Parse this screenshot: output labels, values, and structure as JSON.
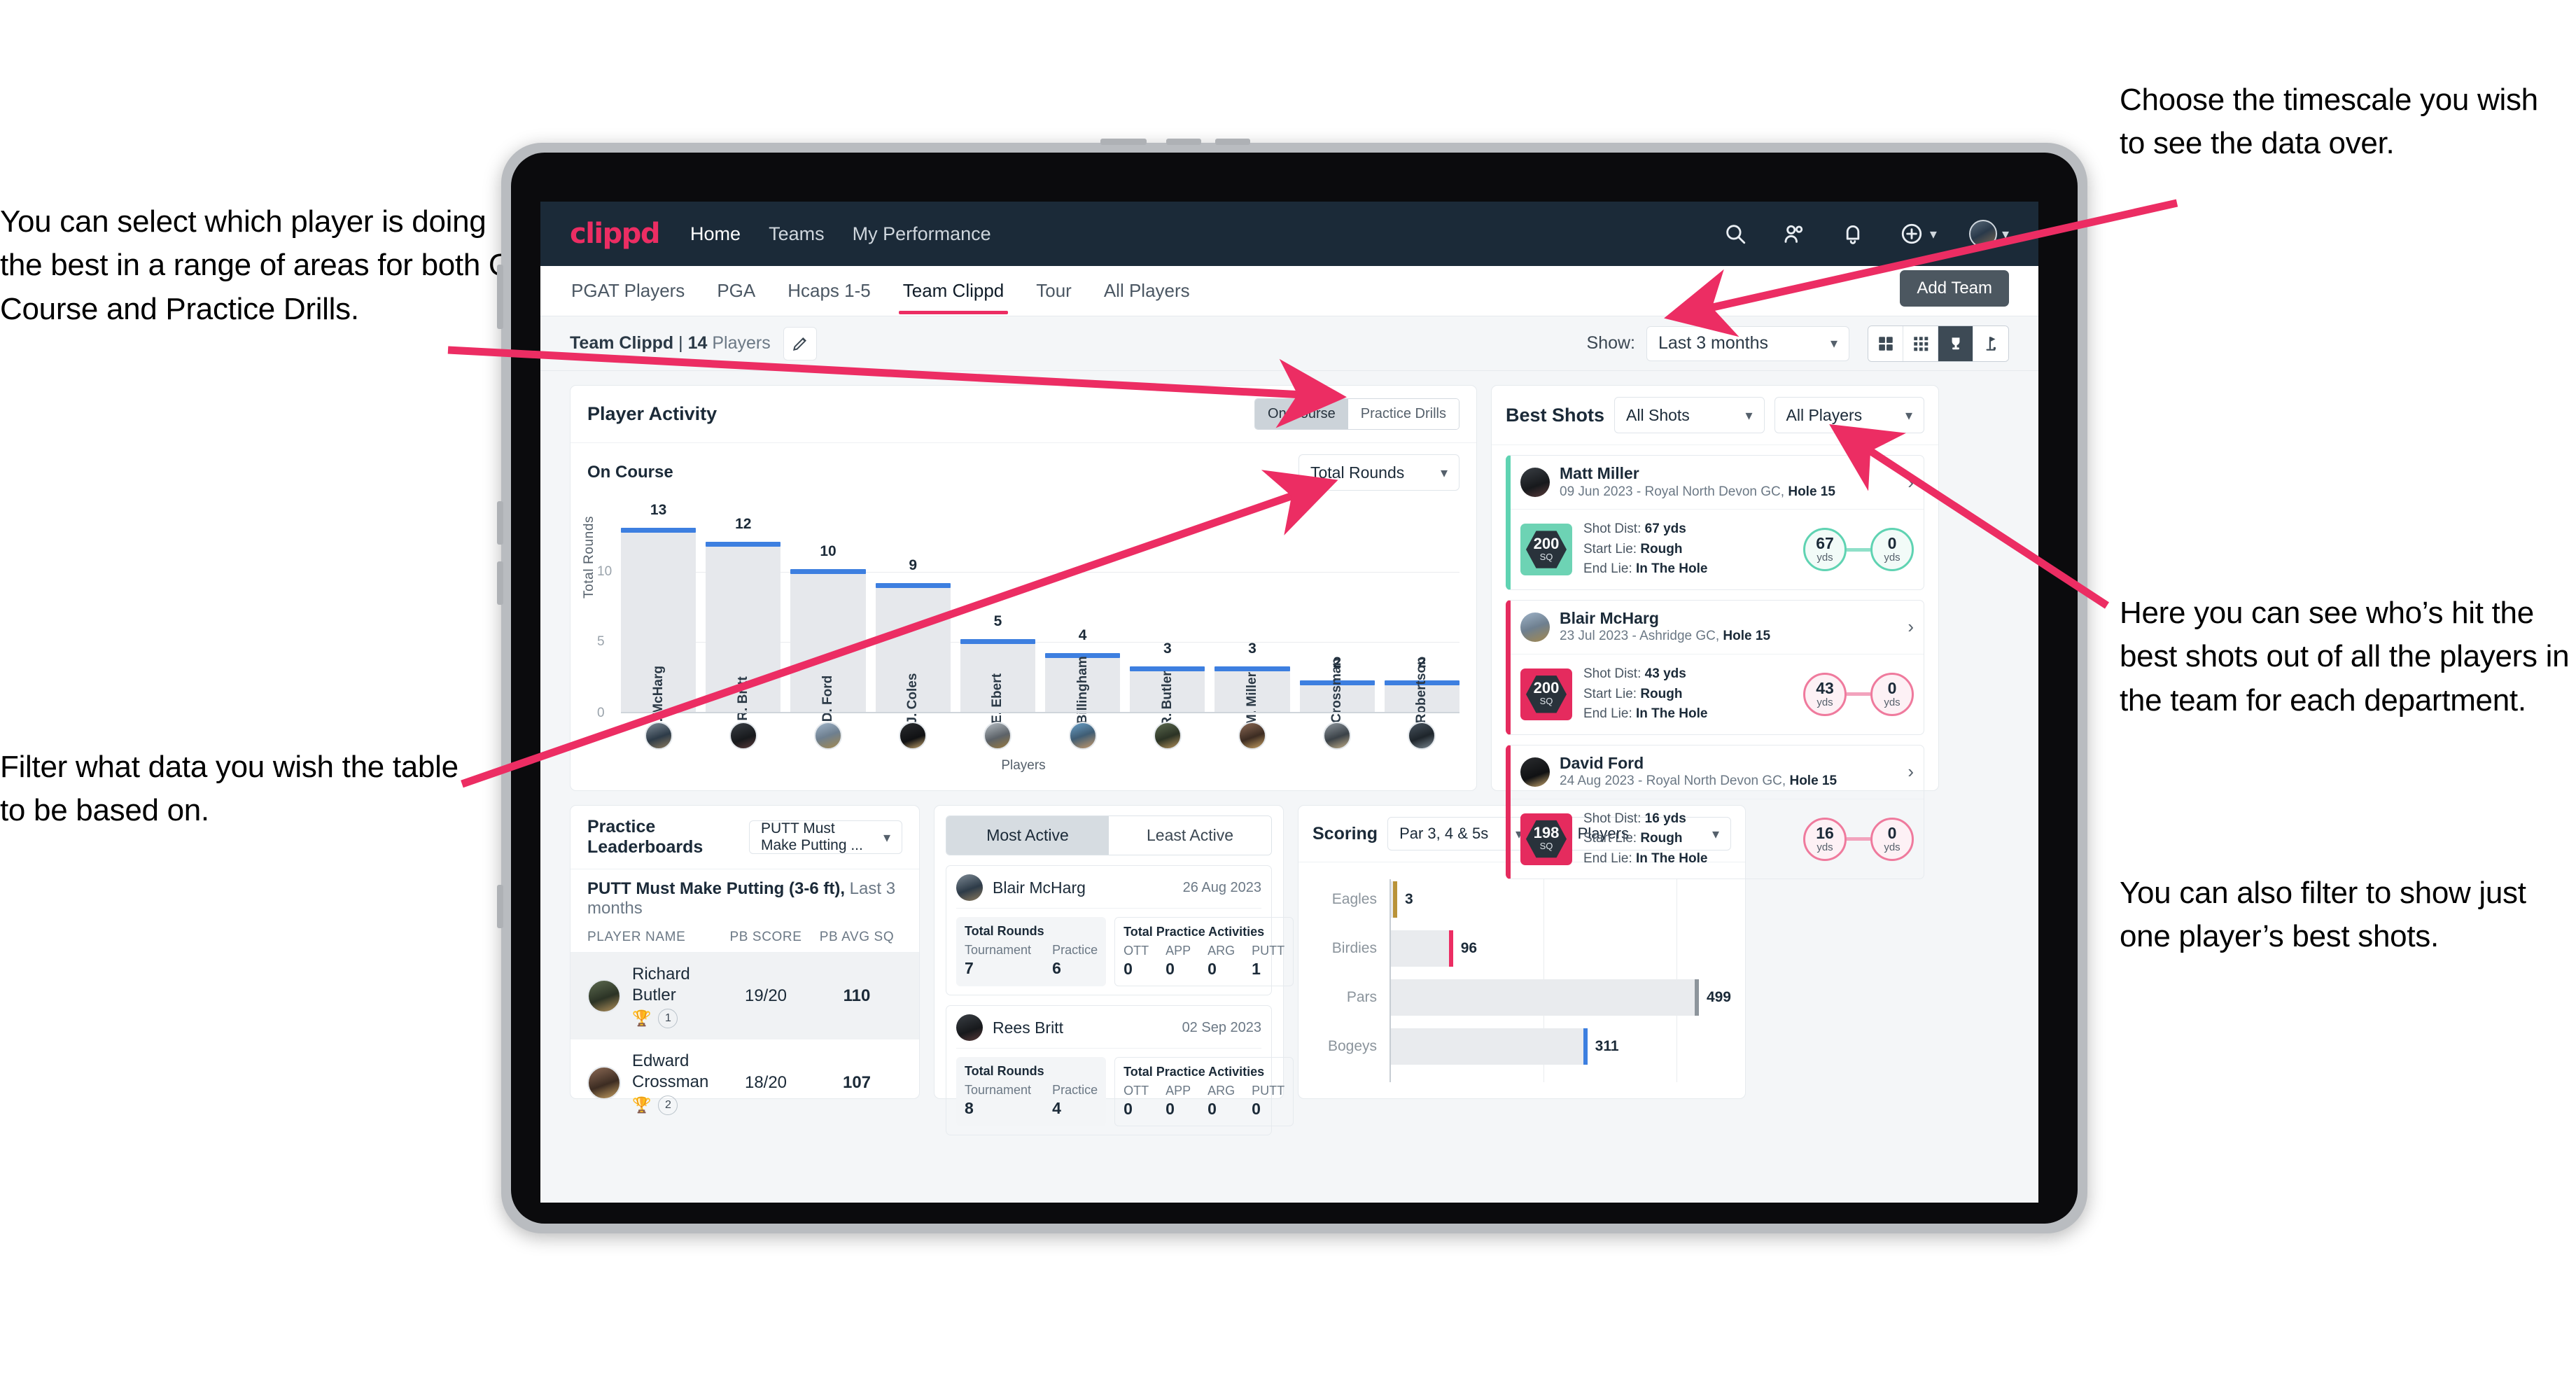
{
  "annotations": {
    "left_top": "You can select which player is doing the best in a range of areas for both On Course and Practice Drills.",
    "left_bottom": "Filter what data you wish the table to be based on.",
    "right_top": "Choose the timescale you wish to see the data over.",
    "right_middle": "Here you can see who’s hit the best shots out of all the players in the team for each department.",
    "right_bottom": "You can also filter to show just one player’s best shots."
  },
  "navbar": {
    "logo": "clippd",
    "links": [
      {
        "label": "Home",
        "active": true
      },
      {
        "label": "Teams",
        "active": false
      },
      {
        "label": "My Performance",
        "active": false
      }
    ],
    "icons": [
      "search-icon",
      "people-icon",
      "bell-icon",
      "plus-circle-icon",
      "avatar"
    ],
    "accent": "#ec2d63",
    "background": "#1b2a38"
  },
  "tabs": {
    "items": [
      "PGAT Players",
      "PGA",
      "Hcaps 1-5",
      "Team Clippd",
      "Tour",
      "All Players"
    ],
    "active": "Team Clippd",
    "tooltip": "Add Team"
  },
  "subheader": {
    "team_name": "Team Clippd",
    "separator": "|",
    "player_count": "14",
    "players_word": "Players",
    "edit_icon": "pencil-icon",
    "show_label": "Show:",
    "timescale": "Last 3 months",
    "view_toggles": [
      {
        "name": "grid-large-icon",
        "active": false
      },
      {
        "name": "grid-small-icon",
        "active": false
      },
      {
        "name": "trophy-icon",
        "active": true
      },
      {
        "name": "flag-icon",
        "active": false
      }
    ]
  },
  "player_activity": {
    "title": "Player Activity",
    "segment": {
      "options": [
        "On Course",
        "Practice Drills"
      ],
      "active": "On Course"
    },
    "sub_label": "On Course",
    "metric_select": "Total Rounds"
  },
  "chart_data": {
    "type": "bar",
    "title": "Player Activity — On Course",
    "xlabel": "Players",
    "ylabel": "Total Rounds",
    "ylim": [
      0,
      14
    ],
    "yticks": [
      0,
      5,
      10
    ],
    "grid": true,
    "categories": [
      "B. McHarg",
      "R. Britt",
      "D. Ford",
      "J. Coles",
      "E. Ebert",
      "D. Billingham",
      "R. Butler",
      "M. Miller",
      "E. Crossman",
      "C. Robertson"
    ],
    "values": [
      13,
      12,
      10,
      9,
      5,
      4,
      3,
      3,
      2,
      2
    ]
  },
  "best_shots": {
    "title": "Best Shots",
    "shot_filter": "All Shots",
    "player_filter": "All Players",
    "items": [
      {
        "player": "Matt Miller",
        "meta_date": "09 Jun 2023",
        "meta_course": "Royal North Devon GC,",
        "meta_hole": "Hole 15",
        "sq": "200",
        "sq_unit": "SQ",
        "shot_dist_label": "Shot Dist:",
        "shot_dist": "67 yds",
        "start_lie_label": "Start Lie:",
        "start_lie": "Rough",
        "end_lie_label": "End Lie:",
        "end_lie": "In The Hole",
        "from_yds": "67",
        "to_yds": "0",
        "unit": "yds",
        "color": "teal"
      },
      {
        "player": "Blair McHarg",
        "meta_date": "23 Jul 2023",
        "meta_course": "Ashridge GC,",
        "meta_hole": "Hole 15",
        "sq": "200",
        "sq_unit": "SQ",
        "shot_dist_label": "Shot Dist:",
        "shot_dist": "43 yds",
        "start_lie_label": "Start Lie:",
        "start_lie": "Rough",
        "end_lie_label": "End Lie:",
        "end_lie": "In The Hole",
        "from_yds": "43",
        "to_yds": "0",
        "unit": "yds",
        "color": "pink"
      },
      {
        "player": "David Ford",
        "meta_date": "24 Aug 2023",
        "meta_course": "Royal North Devon GC,",
        "meta_hole": "Hole 15",
        "sq": "198",
        "sq_unit": "SQ",
        "shot_dist_label": "Shot Dist:",
        "shot_dist": "16 yds",
        "start_lie_label": "Start Lie:",
        "start_lie": "Rough",
        "end_lie_label": "End Lie:",
        "end_lie": "In The Hole",
        "from_yds": "16",
        "to_yds": "0",
        "unit": "yds",
        "color": "pink"
      }
    ]
  },
  "practice_leaderboards": {
    "title": "Practice Leaderboards",
    "drill_select": "PUTT Must Make Putting ...",
    "subtitle_bold": "PUTT Must Make Putting (3-6 ft),",
    "subtitle_muted": "Last 3 months",
    "columns": [
      "PLAYER NAME",
      "PB SCORE",
      "PB AVG SQ"
    ],
    "rows": [
      {
        "name": "Richard Butler",
        "rank": "1",
        "trophy": "gold",
        "pb_score": "19/20",
        "pb_avg_sq": "110",
        "highlighted": true
      },
      {
        "name": "Edward Crossman",
        "rank": "2",
        "trophy": "silver",
        "pb_score": "18/20",
        "pb_avg_sq": "107",
        "highlighted": false
      }
    ]
  },
  "activity_panel": {
    "tabs": [
      "Most Active",
      "Least Active"
    ],
    "active_tab": "Most Active",
    "rounds_title": "Total Rounds",
    "practice_title": "Total Practice Activities",
    "rounds_keys": [
      "Tournament",
      "Practice"
    ],
    "practice_keys": [
      "OTT",
      "APP",
      "ARG",
      "PUTT"
    ],
    "cards": [
      {
        "name": "Blair McHarg",
        "date": "26 Aug 2023",
        "rounds": [
          "7",
          "6"
        ],
        "practice": [
          "0",
          "0",
          "0",
          "1"
        ]
      },
      {
        "name": "Rees Britt",
        "date": "02 Sep 2023",
        "rounds": [
          "8",
          "4"
        ],
        "practice": [
          "0",
          "0",
          "0",
          "0"
        ]
      }
    ]
  },
  "scoring": {
    "title": "Scoring",
    "par_filter": "Par 3, 4 & 5s",
    "player_filter": "All Players",
    "chart": {
      "type": "bar",
      "orientation": "horizontal",
      "categories": [
        "Eagles",
        "Birdies",
        "Pars",
        "Bogeys"
      ],
      "values": [
        3,
        96,
        499,
        311
      ],
      "colors": [
        "#b99339",
        "#ec2d63",
        "#8d959c",
        "#3d7fe0"
      ],
      "xmax": 560
    }
  }
}
